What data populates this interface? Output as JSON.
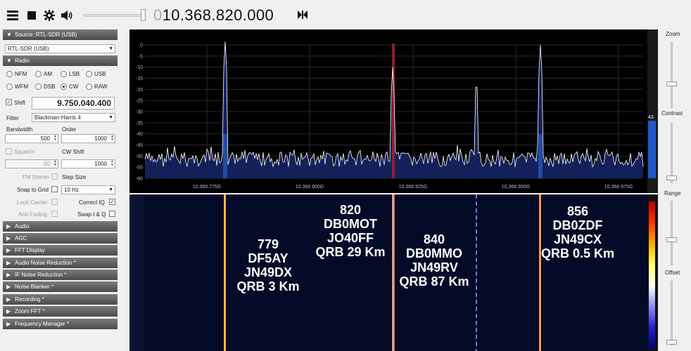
{
  "toolbar": {
    "menu_icon": "hamburger-menu-icon",
    "stop_icon": "stop-icon",
    "settings_icon": "gear-icon",
    "volume_icon": "speaker-icon",
    "frequency_dim": "0",
    "frequency": "10.368.820.000",
    "swap_icon": "swap-icon"
  },
  "source": {
    "header": "Source: RTL-SDR (USB)",
    "device": "RTL-SDR (USB)"
  },
  "radio": {
    "header": "Radio",
    "modes": [
      {
        "label": "NFM",
        "selected": false
      },
      {
        "label": "AM",
        "selected": false
      },
      {
        "label": "LSB",
        "selected": false
      },
      {
        "label": "USB",
        "selected": false
      },
      {
        "label": "WFM",
        "selected": false
      },
      {
        "label": "DSB",
        "selected": false
      },
      {
        "label": "CW",
        "selected": true
      },
      {
        "label": "RAW",
        "selected": false
      }
    ],
    "shift_label": "Shift",
    "shift_checked": true,
    "shift_value": "9.750.040.400",
    "filter_label": "Filter",
    "filter_value": "Blackman-Harris 4",
    "bandwidth_label": "Bandwidth",
    "bandwidth_value": "500",
    "order_label": "Order",
    "order_value": "1000",
    "squelch_label": "Squelch",
    "cw_shift_label": "CW Shift",
    "squelch_value": "50",
    "cw_shift_value": "1000",
    "fm_stereo_label": "FM Stereo",
    "step_size_label": "Step Size",
    "snap_label": "Snap to Grid",
    "step_value": "10 Hz",
    "lock_carrier_label": "Lock Carrier",
    "correct_iq_label": "Correct IQ",
    "anti_fading_label": "Anti-Fading",
    "swap_iq_label": "Swap I & Q"
  },
  "sections": [
    "Audio",
    "AGC",
    "FFT Display",
    "Audio Noise Reduction *",
    "IF Noise Reduction *",
    "Noise Blanker *",
    "Recording *",
    "Zoom FFT *",
    "Frequency Manager *"
  ],
  "spectrum": {
    "y_ticks": [
      "0",
      "-5",
      "-10",
      "-15",
      "-20",
      "-25",
      "-30",
      "-35",
      "-40",
      "-45",
      "-50",
      "-55",
      "-60"
    ],
    "x_ticks": [
      "10,368 775G",
      "10,368 800G",
      "10,368 825G",
      "10,368 850G",
      "10,368 875G"
    ],
    "level_value": "43",
    "trace_color": "#ffffff",
    "fill_color": "#14205a"
  },
  "waterfall": {
    "annotations": [
      {
        "lines": [
          "779",
          "DF5AY",
          "JN49DX",
          "QRB 3 Km"
        ]
      },
      {
        "lines": [
          "820",
          "DB0MOT",
          "JO40FF",
          "QRB 29 Km"
        ]
      },
      {
        "lines": [
          "840",
          "DB0MMO",
          "JN49RV",
          "QRB 87 Km"
        ]
      },
      {
        "lines": [
          "856",
          "DB0ZDF",
          "JN49CX",
          "QRB 0.5 Km"
        ]
      }
    ]
  },
  "right": {
    "zoom_label": "Zoom",
    "contrast_label": "Contrast",
    "range_label": "Range",
    "offset_label": "Offset"
  }
}
